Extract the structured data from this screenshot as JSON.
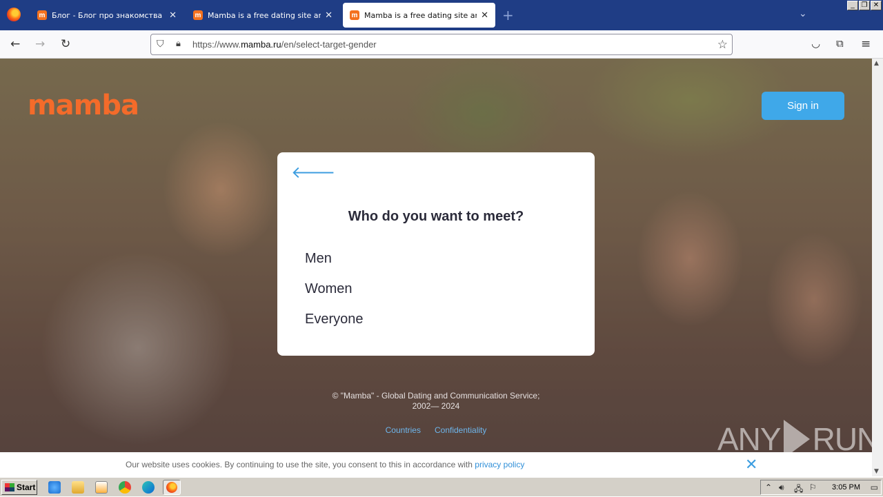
{
  "browser": {
    "tabs": [
      {
        "label": "Блог - Блог про знакомства и отн",
        "favicon": "m",
        "active": false
      },
      {
        "label": "Mamba is a free dating site and a c",
        "favicon": "m",
        "active": false
      },
      {
        "label": "Mamba is a free dating site and a c",
        "favicon": "m",
        "active": true
      }
    ],
    "new_tab": "+",
    "url_prefix": "https://www.",
    "url_domain": "mamba.ru",
    "url_path": "/en/select-target-gender"
  },
  "site": {
    "logo": "mamba",
    "sign_in": "Sign in",
    "brand_color": "#f46b2a",
    "accent_color": "#3fa8e9"
  },
  "card": {
    "question": "Who do you want to meet?",
    "options": [
      "Men",
      "Women",
      "Everyone"
    ]
  },
  "footer": {
    "copyright_line1": "© \"Mamba\" - Global Dating and Communication Service;",
    "copyright_line2": "2002— 2024",
    "links": [
      "Countries",
      "Confidentiality"
    ]
  },
  "cookie": {
    "text": "Our website uses cookies. By continuing to use the site, you consent to this in accordance with",
    "link": "privacy policy"
  },
  "watermark": {
    "left": "ANY",
    "right": "RUN"
  },
  "taskbar": {
    "start": "Start",
    "clock": "3:05 PM"
  }
}
